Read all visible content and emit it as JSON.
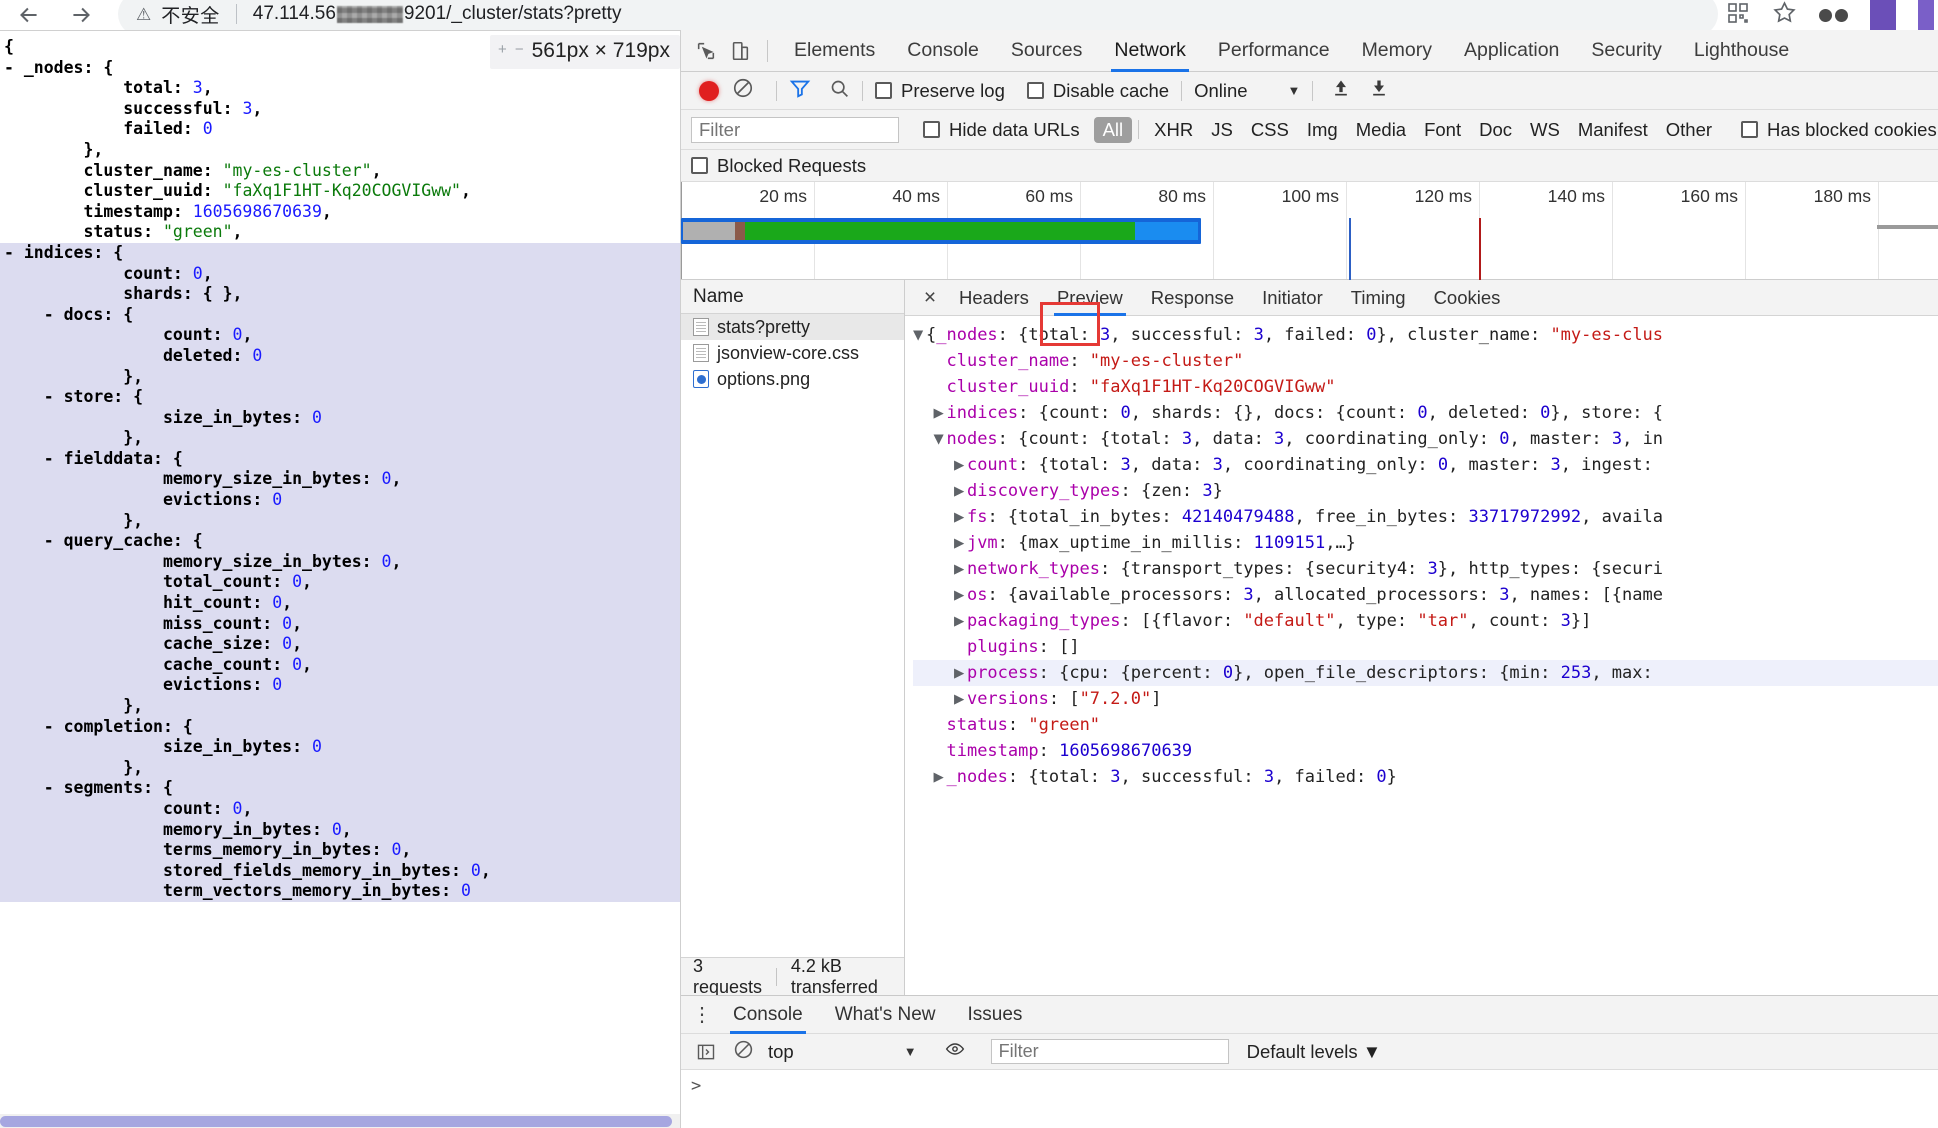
{
  "browser": {
    "nav": {
      "back": "back-arrow",
      "forward": "forward-arrow",
      "reload": "reload"
    },
    "security_warning": "不安全",
    "url_prefix": "47.114.56",
    "url_suffix": "9201/_cluster/stats?pretty",
    "full_url": "47.114.56███9201/_cluster/stats?pretty"
  },
  "viewport_tip": {
    "minus": "−",
    "plus": "+",
    "size": "561px × 719px"
  },
  "json_viewer": {
    "lines": [
      {
        "indent": 0,
        "toggle": "",
        "text": "{",
        "hl": false
      },
      {
        "indent": 1,
        "toggle": "-",
        "key": "_nodes",
        "after": ": {",
        "hl": false
      },
      {
        "indent": 3,
        "key": "total",
        "num": "3",
        "after": ",",
        "hl": false
      },
      {
        "indent": 3,
        "key": "successful",
        "num": "3",
        "after": ",",
        "hl": false
      },
      {
        "indent": 3,
        "key": "failed",
        "num": "0",
        "after": "",
        "hl": false
      },
      {
        "indent": 2,
        "text": "},",
        "hl": false
      },
      {
        "indent": 2,
        "key": "cluster_name",
        "str": "\"my-es-cluster\"",
        "after": ",",
        "hl": false
      },
      {
        "indent": 2,
        "key": "cluster_uuid",
        "str": "\"faXq1F1HT-Kq20COGVIGww\"",
        "after": ",",
        "hl": false
      },
      {
        "indent": 2,
        "key": "timestamp",
        "num": "1605698670639",
        "after": ",",
        "hl": false
      },
      {
        "indent": 2,
        "key": "status",
        "str": "\"green\"",
        "after": ",",
        "hl": false
      },
      {
        "indent": 1,
        "toggle": "-",
        "key": "indices",
        "after": ": {",
        "hl": true
      },
      {
        "indent": 3,
        "key": "count",
        "num": "0",
        "after": ",",
        "hl": true
      },
      {
        "indent": 3,
        "key": "shards",
        "after": ": { },",
        "hl": true
      },
      {
        "indent": 2,
        "toggle": "-",
        "key": "docs",
        "after": ": {",
        "hl": true
      },
      {
        "indent": 4,
        "key": "count",
        "num": "0",
        "after": ",",
        "hl": true
      },
      {
        "indent": 4,
        "key": "deleted",
        "num": "0",
        "after": "",
        "hl": true
      },
      {
        "indent": 3,
        "text": "},",
        "hl": true
      },
      {
        "indent": 2,
        "toggle": "-",
        "key": "store",
        "after": ": {",
        "hl": true
      },
      {
        "indent": 4,
        "key": "size_in_bytes",
        "num": "0",
        "after": "",
        "hl": true
      },
      {
        "indent": 3,
        "text": "},",
        "hl": true
      },
      {
        "indent": 2,
        "toggle": "-",
        "key": "fielddata",
        "after": ": {",
        "hl": true
      },
      {
        "indent": 4,
        "key": "memory_size_in_bytes",
        "num": "0",
        "after": ",",
        "hl": true
      },
      {
        "indent": 4,
        "key": "evictions",
        "num": "0",
        "after": "",
        "hl": true
      },
      {
        "indent": 3,
        "text": "},",
        "hl": true
      },
      {
        "indent": 2,
        "toggle": "-",
        "key": "query_cache",
        "after": ": {",
        "hl": true
      },
      {
        "indent": 4,
        "key": "memory_size_in_bytes",
        "num": "0",
        "after": ",",
        "hl": true
      },
      {
        "indent": 4,
        "key": "total_count",
        "num": "0",
        "after": ",",
        "hl": true
      },
      {
        "indent": 4,
        "key": "hit_count",
        "num": "0",
        "after": ",",
        "hl": true
      },
      {
        "indent": 4,
        "key": "miss_count",
        "num": "0",
        "after": ",",
        "hl": true
      },
      {
        "indent": 4,
        "key": "cache_size",
        "num": "0",
        "after": ",",
        "hl": true
      },
      {
        "indent": 4,
        "key": "cache_count",
        "num": "0",
        "after": ",",
        "hl": true
      },
      {
        "indent": 4,
        "key": "evictions",
        "num": "0",
        "after": "",
        "hl": true
      },
      {
        "indent": 3,
        "text": "},",
        "hl": true
      },
      {
        "indent": 2,
        "toggle": "-",
        "key": "completion",
        "after": ": {",
        "hl": true
      },
      {
        "indent": 4,
        "key": "size_in_bytes",
        "num": "0",
        "after": "",
        "hl": true
      },
      {
        "indent": 3,
        "text": "},",
        "hl": true
      },
      {
        "indent": 2,
        "toggle": "-",
        "key": "segments",
        "after": ": {",
        "hl": true
      },
      {
        "indent": 4,
        "key": "count",
        "num": "0",
        "after": ",",
        "hl": true
      },
      {
        "indent": 4,
        "key": "memory_in_bytes",
        "num": "0",
        "after": ",",
        "hl": true
      },
      {
        "indent": 4,
        "key": "terms_memory_in_bytes",
        "num": "0",
        "after": ",",
        "hl": true
      },
      {
        "indent": 4,
        "key": "stored_fields_memory_in_bytes",
        "num": "0",
        "after": ",",
        "hl": true
      },
      {
        "indent": 4,
        "key": "term_vectors_memory_in_bytes",
        "num": "0",
        "after": "",
        "hl": true
      }
    ]
  },
  "devtools": {
    "panel_tabs": [
      {
        "label": "Elements",
        "active": false
      },
      {
        "label": "Console",
        "active": false
      },
      {
        "label": "Sources",
        "active": false
      },
      {
        "label": "Network",
        "active": true
      },
      {
        "label": "Performance",
        "active": false
      },
      {
        "label": "Memory",
        "active": false
      },
      {
        "label": "Application",
        "active": false
      },
      {
        "label": "Security",
        "active": false
      },
      {
        "label": "Lighthouse",
        "active": false
      }
    ],
    "toolbar": {
      "record_tooltip": "record-button",
      "clear_tooltip": "clear-button",
      "filter_tooltip": "filter-toggle",
      "search_tooltip": "search",
      "preserve_log": "Preserve log",
      "disable_cache": "Disable cache",
      "throttling": "Online",
      "import_tooltip": "import-har",
      "export_tooltip": "export-har"
    },
    "filterbar": {
      "filter_placeholder": "Filter",
      "hide_data_urls": "Hide data URLs",
      "types": [
        "All",
        "XHR",
        "JS",
        "CSS",
        "Img",
        "Media",
        "Font",
        "Doc",
        "WS",
        "Manifest",
        "Other"
      ],
      "selected_type": "All",
      "has_blocked_cookies": "Has blocked cookies"
    },
    "blocked_requests": "Blocked Requests",
    "overview": {
      "ticks": [
        "20 ms",
        "40 ms",
        "60 ms",
        "80 ms",
        "100 ms",
        "120 ms",
        "140 ms",
        "160 ms",
        "180 ms"
      ],
      "dom_content_loaded_color": "#2c5fc4",
      "load_event_color": "#b11a1a",
      "bar_colors": {
        "outer": "#1565d8",
        "queue": "#b0b0b0",
        "stalled": "#8b5a4a",
        "download": "#1aa81a",
        "wait": "#1a8cf0"
      }
    },
    "requests": {
      "column": "Name",
      "rows": [
        {
          "name": "stats?pretty",
          "type": "doc",
          "selected": true
        },
        {
          "name": "jsonview-core.css",
          "type": "css",
          "selected": false
        },
        {
          "name": "options.png",
          "type": "img",
          "selected": false
        }
      ],
      "summary_count": "3 requests",
      "summary_transferred": "4.2 kB transferred"
    },
    "detail": {
      "close": "×",
      "tabs": [
        {
          "label": "Headers",
          "active": false
        },
        {
          "label": "Preview",
          "active": true
        },
        {
          "label": "Response",
          "active": false
        },
        {
          "label": "Initiator",
          "active": false
        },
        {
          "label": "Timing",
          "active": false
        },
        {
          "label": "Cookies",
          "active": false
        }
      ],
      "preview_lines": [
        {
          "tri": "▼",
          "indent": 0,
          "segs": [
            [
              "plain",
              "{"
            ],
            [
              "key",
              "_nodes"
            ],
            [
              "plain",
              ": {total: "
            ],
            [
              "num",
              "3"
            ],
            [
              "plain",
              ", successful: "
            ],
            [
              "num",
              "3"
            ],
            [
              "plain",
              ", failed: "
            ],
            [
              "num",
              "0"
            ],
            [
              "plain",
              "}, cluster_name: "
            ],
            [
              "str",
              "\"my-es-clus"
            ]
          ],
          "hl": false
        },
        {
          "tri": "",
          "indent": 1,
          "segs": [
            [
              "key",
              "cluster_name"
            ],
            [
              "plain",
              ": "
            ],
            [
              "str",
              "\"my-es-cluster\""
            ]
          ],
          "hl": false
        },
        {
          "tri": "",
          "indent": 1,
          "segs": [
            [
              "key",
              "cluster_uuid"
            ],
            [
              "plain",
              ": "
            ],
            [
              "str",
              "\"faXq1F1HT-Kq20COGVIGww\""
            ]
          ],
          "hl": false
        },
        {
          "tri": "▶",
          "indent": 1,
          "segs": [
            [
              "key",
              "indices"
            ],
            [
              "plain",
              ": {count: "
            ],
            [
              "num",
              "0"
            ],
            [
              "plain",
              ", shards: {}, docs: {count: "
            ],
            [
              "num",
              "0"
            ],
            [
              "plain",
              ", deleted: "
            ],
            [
              "num",
              "0"
            ],
            [
              "plain",
              "}, store: {"
            ]
          ],
          "hl": false
        },
        {
          "tri": "▼",
          "indent": 1,
          "segs": [
            [
              "key",
              "nodes"
            ],
            [
              "plain",
              ": {count: {total: "
            ],
            [
              "num",
              "3"
            ],
            [
              "plain",
              ", data: "
            ],
            [
              "num",
              "3"
            ],
            [
              "plain",
              ", coordinating_only: "
            ],
            [
              "num",
              "0"
            ],
            [
              "plain",
              ", master: "
            ],
            [
              "num",
              "3"
            ],
            [
              "plain",
              ", in"
            ]
          ],
          "hl": false
        },
        {
          "tri": "▶",
          "indent": 2,
          "segs": [
            [
              "key",
              "count"
            ],
            [
              "plain",
              ": {total: "
            ],
            [
              "num",
              "3"
            ],
            [
              "plain",
              ", data: "
            ],
            [
              "num",
              "3"
            ],
            [
              "plain",
              ", coordinating_only: "
            ],
            [
              "num",
              "0"
            ],
            [
              "plain",
              ", master: "
            ],
            [
              "num",
              "3"
            ],
            [
              "plain",
              ", ingest: "
            ]
          ],
          "hl": false
        },
        {
          "tri": "▶",
          "indent": 2,
          "segs": [
            [
              "key",
              "discovery_types"
            ],
            [
              "plain",
              ": {zen: "
            ],
            [
              "num",
              "3"
            ],
            [
              "plain",
              "}"
            ]
          ],
          "hl": false
        },
        {
          "tri": "▶",
          "indent": 2,
          "segs": [
            [
              "key",
              "fs"
            ],
            [
              "plain",
              ": {total_in_bytes: "
            ],
            [
              "num",
              "42140479488"
            ],
            [
              "plain",
              ", free_in_bytes: "
            ],
            [
              "num",
              "33717972992"
            ],
            [
              "plain",
              ", availa"
            ]
          ],
          "hl": false
        },
        {
          "tri": "▶",
          "indent": 2,
          "segs": [
            [
              "key",
              "jvm"
            ],
            [
              "plain",
              ": {max_uptime_in_millis: "
            ],
            [
              "num",
              "1109151"
            ],
            [
              "plain",
              ",…}"
            ]
          ],
          "hl": false
        },
        {
          "tri": "▶",
          "indent": 2,
          "segs": [
            [
              "key",
              "network_types"
            ],
            [
              "plain",
              ": {transport_types: {security4: "
            ],
            [
              "num",
              "3"
            ],
            [
              "plain",
              "}, http_types: {securi"
            ]
          ],
          "hl": false
        },
        {
          "tri": "▶",
          "indent": 2,
          "segs": [
            [
              "key",
              "os"
            ],
            [
              "plain",
              ": {available_processors: "
            ],
            [
              "num",
              "3"
            ],
            [
              "plain",
              ", allocated_processors: "
            ],
            [
              "num",
              "3"
            ],
            [
              "plain",
              ", names: [{name"
            ]
          ],
          "hl": false
        },
        {
          "tri": "▶",
          "indent": 2,
          "segs": [
            [
              "key",
              "packaging_types"
            ],
            [
              "plain",
              ": [{flavor: "
            ],
            [
              "str",
              "\"default\""
            ],
            [
              "plain",
              ", type: "
            ],
            [
              "str",
              "\"tar\""
            ],
            [
              "plain",
              ", count: "
            ],
            [
              "num",
              "3"
            ],
            [
              "plain",
              "}]"
            ]
          ],
          "hl": false
        },
        {
          "tri": "",
          "indent": 2,
          "segs": [
            [
              "key",
              "plugins"
            ],
            [
              "plain",
              ": []"
            ]
          ],
          "hl": false
        },
        {
          "tri": "▶",
          "indent": 2,
          "segs": [
            [
              "key",
              "process"
            ],
            [
              "plain",
              ": {cpu: {percent: "
            ],
            [
              "num",
              "0"
            ],
            [
              "plain",
              "}, open_file_descriptors: {min: "
            ],
            [
              "num",
              "253"
            ],
            [
              "plain",
              ", max: "
            ]
          ],
          "hl": true
        },
        {
          "tri": "▶",
          "indent": 2,
          "segs": [
            [
              "key",
              "versions"
            ],
            [
              "plain",
              ": ["
            ],
            [
              "str",
              "\"7.2.0\""
            ],
            [
              "plain",
              "]"
            ]
          ],
          "hl": false
        },
        {
          "tri": "",
          "indent": 1,
          "segs": [
            [
              "key",
              "status"
            ],
            [
              "plain",
              ": "
            ],
            [
              "str",
              "\"green\""
            ]
          ],
          "hl": false
        },
        {
          "tri": "",
          "indent": 1,
          "segs": [
            [
              "key",
              "timestamp"
            ],
            [
              "plain",
              ": "
            ],
            [
              "num",
              "1605698670639"
            ]
          ],
          "hl": false
        },
        {
          "tri": "▶",
          "indent": 1,
          "segs": [
            [
              "key",
              "_nodes"
            ],
            [
              "plain",
              ": {total: "
            ],
            [
              "num",
              "3"
            ],
            [
              "plain",
              ", successful: "
            ],
            [
              "num",
              "3"
            ],
            [
              "plain",
              ", failed: "
            ],
            [
              "num",
              "0"
            ],
            [
              "plain",
              "}"
            ]
          ],
          "hl": false
        }
      ]
    },
    "drawer": {
      "tabs": [
        {
          "label": "Console",
          "active": true
        },
        {
          "label": "What's New",
          "active": false
        },
        {
          "label": "Issues",
          "active": false
        }
      ],
      "context": "top",
      "filter_placeholder": "Filter",
      "levels": "Default levels",
      "prompt": ">"
    }
  }
}
